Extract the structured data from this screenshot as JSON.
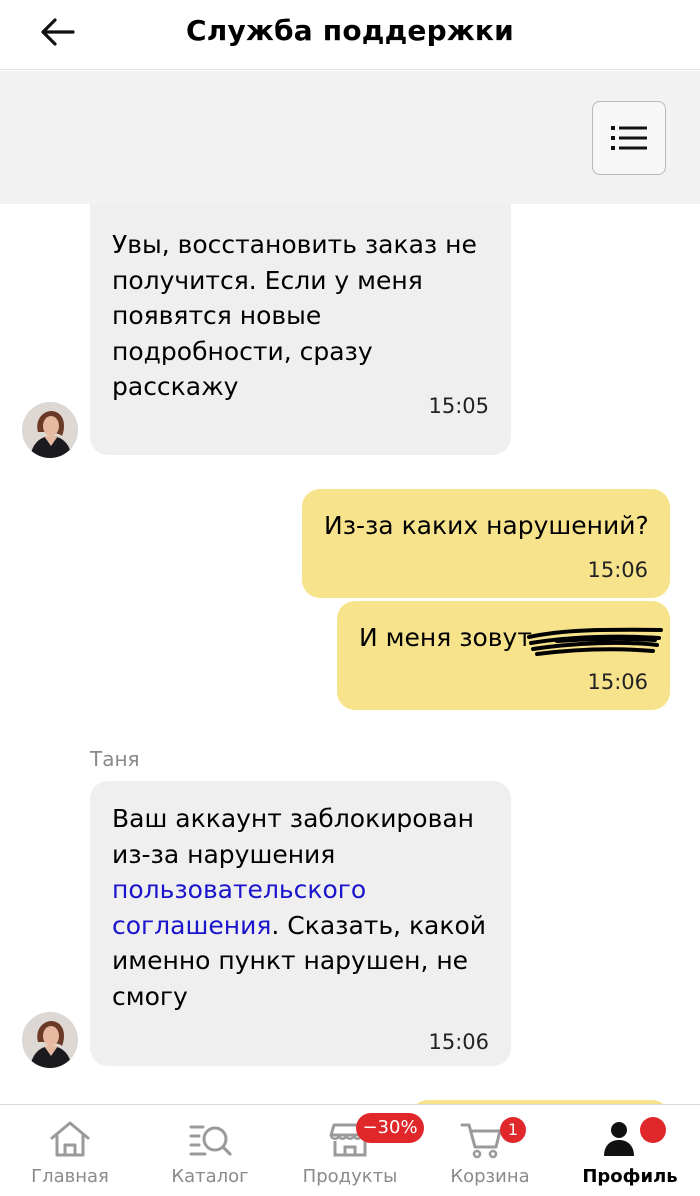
{
  "header": {
    "title": "Служба поддержки"
  },
  "messages": [
    {
      "direction": "incoming",
      "text": "Увы, восстановить заказ не получится. Если у меня появятся новые подробности, сразу расскажу",
      "time": "15:05"
    },
    {
      "direction": "outgoing",
      "text": "Из-за каких нарушений?",
      "time": "15:06"
    },
    {
      "direction": "outgoing",
      "text": "И меня зовут",
      "time": "15:06"
    },
    {
      "direction": "incoming",
      "sender": "Таня",
      "text_before": "Ваш аккаунт заблокирован из-за нарушения ",
      "link_text": "пользовательского соглашения",
      "text_after": ". Сказать, какой именно пункт нарушен, не смогу",
      "time": "15:06"
    }
  ],
  "bottom_nav": {
    "items": [
      {
        "label": "Главная",
        "icon": "home-icon"
      },
      {
        "label": "Каталог",
        "icon": "catalog-search-icon"
      },
      {
        "label": "Продукты",
        "icon": "store-icon",
        "badge": "−30%"
      },
      {
        "label": "Корзина",
        "icon": "cart-icon",
        "badge": "1"
      },
      {
        "label": "Профиль",
        "icon": "profile-icon",
        "active": true
      }
    ]
  },
  "colors": {
    "outgoing_bubble": "#f8e38d",
    "incoming_bubble": "#efefef",
    "link": "#1a14cc",
    "badge": "#e0282b"
  }
}
